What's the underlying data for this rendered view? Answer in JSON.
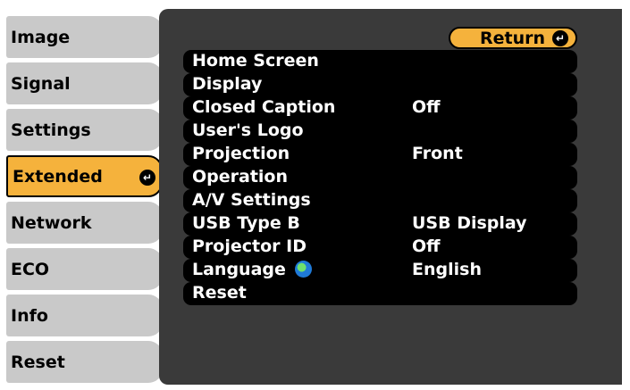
{
  "tabs": [
    {
      "label": "Image"
    },
    {
      "label": "Signal"
    },
    {
      "label": "Settings"
    },
    {
      "label": "Extended",
      "selected": true
    },
    {
      "label": "Network"
    },
    {
      "label": "ECO"
    },
    {
      "label": "Info"
    },
    {
      "label": "Reset"
    }
  ],
  "return_label": "Return",
  "menu": [
    {
      "label": "Home Screen",
      "value": ""
    },
    {
      "label": "Display",
      "value": ""
    },
    {
      "label": "Closed Caption",
      "value": "Off"
    },
    {
      "label": "User's Logo",
      "value": ""
    },
    {
      "label": "Projection",
      "value": "Front"
    },
    {
      "label": "Operation",
      "value": ""
    },
    {
      "label": "A/V Settings",
      "value": ""
    },
    {
      "label": "USB Type B",
      "value": "USB Display"
    },
    {
      "label": "Projector ID",
      "value": "Off"
    },
    {
      "label": "Language",
      "value": "English",
      "icon": "globe-icon"
    },
    {
      "label": "Reset",
      "value": ""
    }
  ],
  "colors": {
    "panel": "#3a3a3a",
    "tab": "#c9c9c9",
    "selected": "#f5b23c",
    "row": "#000000",
    "text_light": "#ffffff"
  }
}
